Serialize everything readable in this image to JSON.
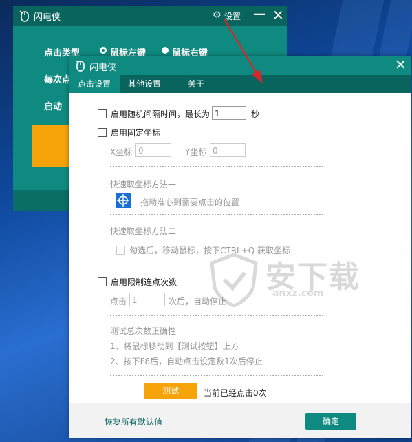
{
  "back_window": {
    "title": "闪电侠",
    "settings_label": "设置",
    "row1_label": "点击类型",
    "opt1": "鼠标左键",
    "opt2": "鼠标右键",
    "row2_label": "每次点",
    "row3_label": "启动"
  },
  "front_window": {
    "title": "闪电侠",
    "tabs": [
      {
        "label": "点击设置"
      },
      {
        "label": "其他设置"
      },
      {
        "label": "关于"
      }
    ],
    "random_interval": {
      "label": "启用随机间隔时间，最长为",
      "value": "1",
      "unit": "秒"
    },
    "fixed_coord": {
      "label": "启用固定坐标",
      "x_label": "X坐标",
      "x_value": "0",
      "y_label": "Y坐标",
      "y_value": "0",
      "method1_title": "快速取坐标方法一",
      "method1_text": "拖动准心到需要点击的位置",
      "method2_title": "快速取坐标方法二",
      "method2_text": "勾选后，移动鼠标，按下CTRL+Q 获取坐标"
    },
    "limit_clicks": {
      "label": "启用限制连点次数",
      "prefix": "点击",
      "value": "1",
      "suffix": "次后，自动停止"
    },
    "test_section": {
      "title": "测试总次数正确性",
      "step1": "1、将鼠标移动到【测试按钮】上方",
      "step2": "2、按下F8后，自动点击设定数1次后停止",
      "button": "测试",
      "status": "当前已经点击0次"
    },
    "footer": {
      "restore_label": "恢复所有默认值",
      "ok_label": "确定"
    }
  },
  "watermark": {
    "text": "安下载",
    "url": "anxz.com"
  },
  "colors": {
    "teal": "#0f8a80",
    "teal_dark": "#0a645e",
    "orange": "#f6a30a",
    "arrow_red": "#d8262a"
  }
}
